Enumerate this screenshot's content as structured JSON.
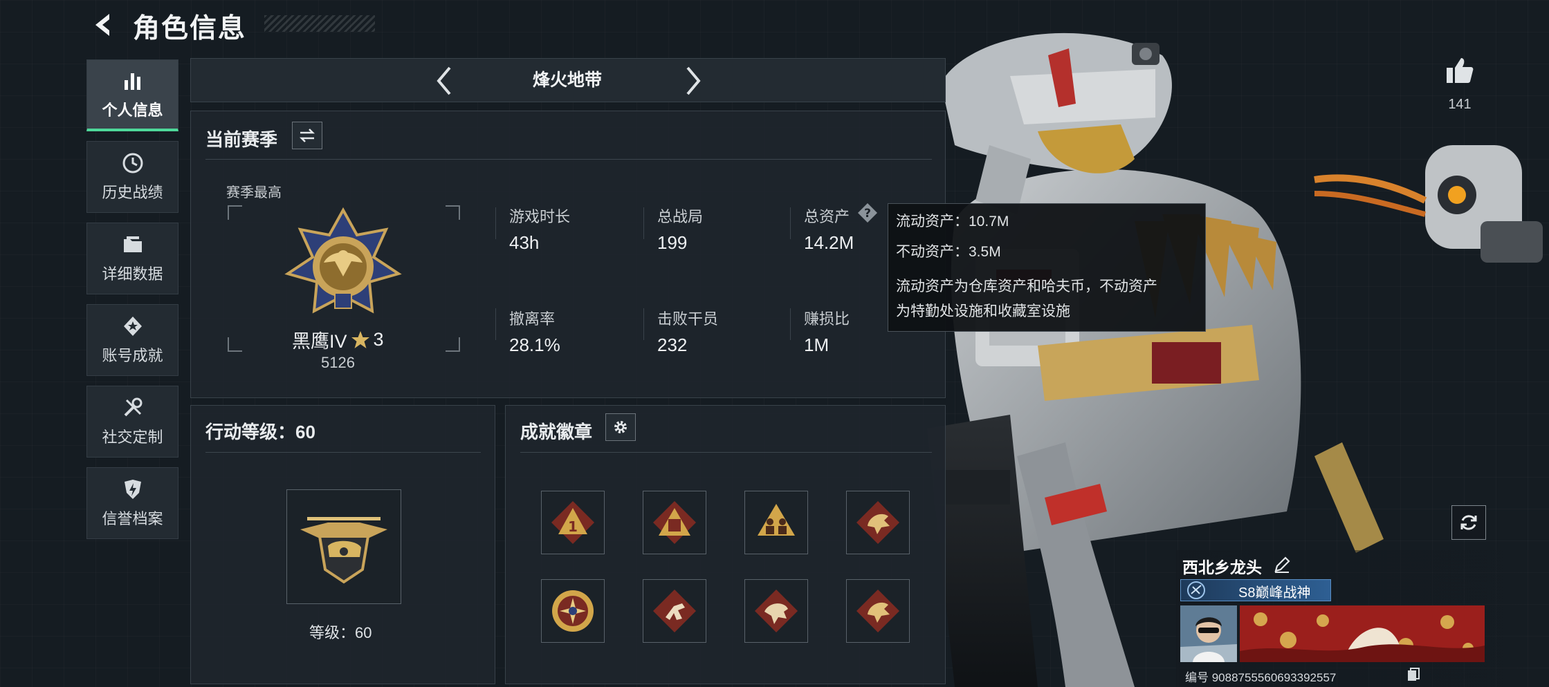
{
  "header": {
    "title": "角色信息"
  },
  "nav": {
    "items": [
      {
        "label": "个人信息",
        "icon": "bar-chart-icon",
        "active": true
      },
      {
        "label": "历史战绩",
        "icon": "clock-icon",
        "active": false
      },
      {
        "label": "详细数据",
        "icon": "folder-icon",
        "active": false
      },
      {
        "label": "账号成就",
        "icon": "medal-star-icon",
        "active": false
      },
      {
        "label": "社交定制",
        "icon": "tools-icon",
        "active": false
      },
      {
        "label": "信誉档案",
        "icon": "shield-bolt-icon",
        "active": false
      }
    ]
  },
  "mode": {
    "title": "烽火地带"
  },
  "season": {
    "title": "当前赛季",
    "best_label": "赛季最高",
    "rank_name": "黑鹰IV",
    "rank_stars": "3",
    "rank_score": "5126",
    "stats": [
      {
        "label": "游戏时长",
        "value": "43h"
      },
      {
        "label": "总战局",
        "value": "199"
      },
      {
        "label": "总资产",
        "value": "14.2M"
      },
      {
        "label": "撤离率",
        "value": "28.1%"
      },
      {
        "label": "击败干员",
        "value": "232"
      },
      {
        "label": "赚损比",
        "value": "1M"
      }
    ]
  },
  "tooltip": {
    "line1": "流动资产：10.7M",
    "line2": "不动资产：3.5M",
    "desc1": "流动资产为仓库资产和哈夫币，不动资产",
    "desc2": "为特勤处设施和收藏室设施"
  },
  "level": {
    "title": "行动等级：60",
    "caption": "等级：60"
  },
  "badges": {
    "title": "成就徽章",
    "items": [
      "badge-rank-1",
      "badge-supply",
      "badge-squad",
      "badge-dragon",
      "badge-cross-medal",
      "badge-runner",
      "badge-dragon-2",
      "badge-dragon-3"
    ]
  },
  "profile": {
    "like_count": "141",
    "player_name": "西北乡龙头",
    "honor_title": "S8巅峰战神",
    "uid": "编号 9088755560693392557"
  },
  "colors": {
    "accent": "#4ed99a",
    "gold": "#c9a45a",
    "badge_bg": "#7a2a22"
  }
}
